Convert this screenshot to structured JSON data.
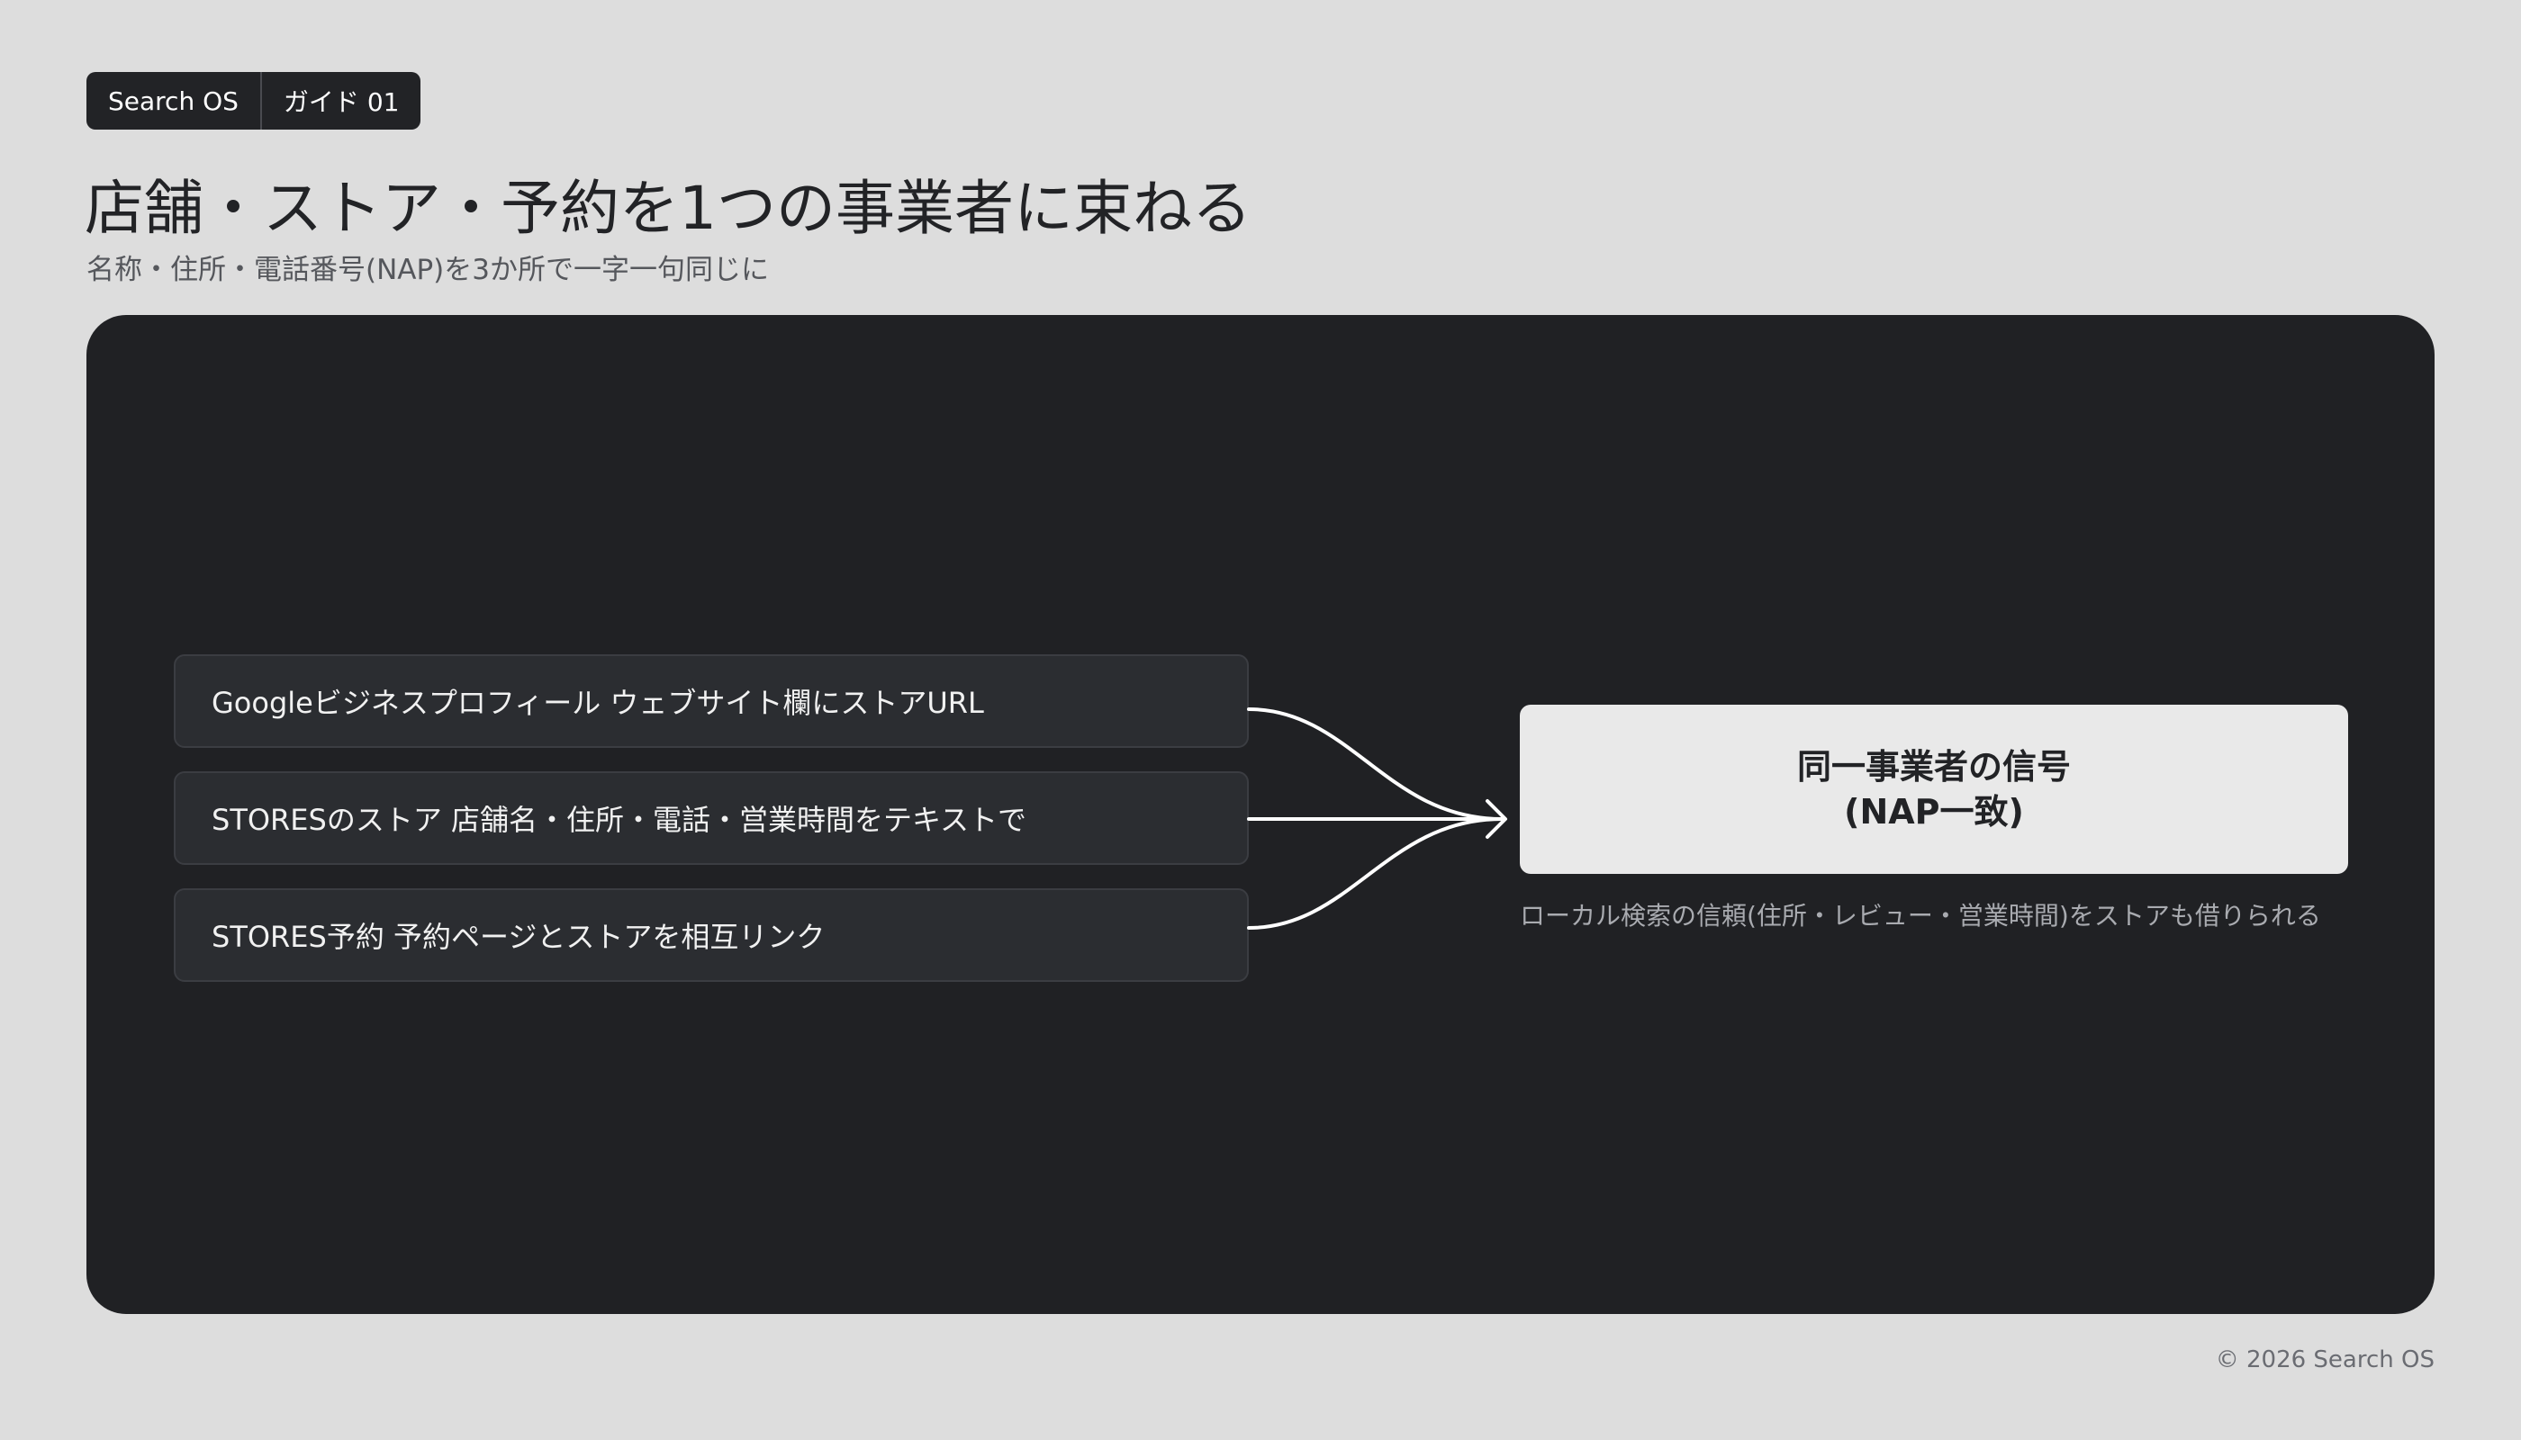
{
  "header": {
    "badge_brand": "Search OS",
    "badge_guide": "ガイド 01",
    "title": "店舗・ストア・予約を1つの事業者に束ねる",
    "subtitle": "名称・住所・電話番号(NAP)を3か所で一字一句同じに"
  },
  "diagram": {
    "sources": [
      "Googleビジネスプロフィール ウェブサイト欄にストアURL",
      "STORESのストア 店舗名・住所・電話・営業時間をテキストで",
      "STORES予約 予約ページとストアを相互リンク"
    ],
    "target_line1": "同一事業者の信号",
    "target_line2": "(NAP一致)",
    "target_note": "ローカル検索の信頼(住所・レビュー・営業時間)をストアも借りられる"
  },
  "colors": {
    "background": "#dddddd",
    "panel": "#202124",
    "source_box": "#2b2d31",
    "target_box": "#e9e9e9",
    "connector": "#ffffff"
  },
  "footer": {
    "copyright": "© 2026 Search OS"
  }
}
